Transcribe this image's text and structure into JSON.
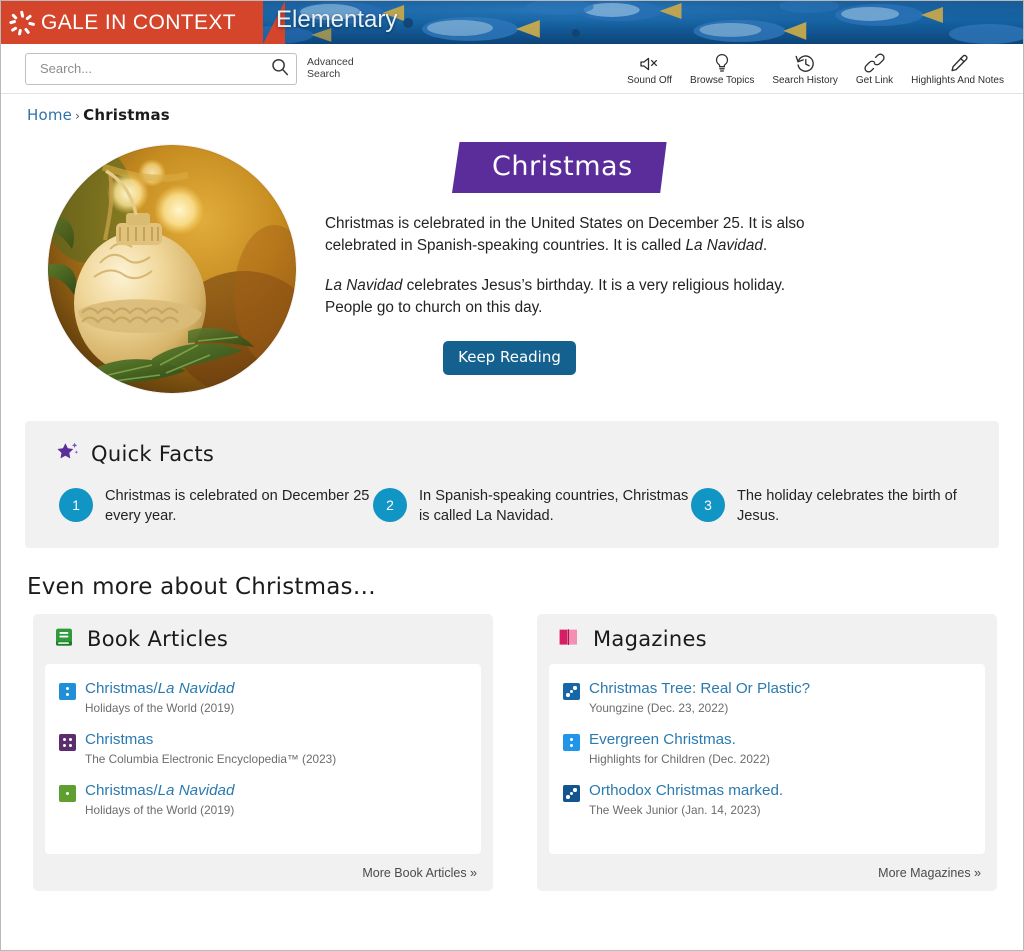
{
  "header": {
    "brand": "GALE IN CONTEXT",
    "edition": "Elementary",
    "logo_icon": "gale-starburst-icon",
    "banner_image_alt": "blue tang fish swimming underwater",
    "brand_color": "#d4452c",
    "banner_color": "#15538f"
  },
  "search": {
    "placeholder": "Search...",
    "value": "",
    "icon": "search-icon",
    "advanced_line1": "Advanced",
    "advanced_line2": "Search"
  },
  "tools": [
    {
      "label": "Sound Off",
      "icon": "speaker-mute-icon"
    },
    {
      "label": "Browse Topics",
      "icon": "lightbulb-icon"
    },
    {
      "label": "Search History",
      "icon": "clock-rewind-icon"
    },
    {
      "label": "Get Link",
      "icon": "link-chain-icon"
    },
    {
      "label": "Highlights And Notes",
      "icon": "highlighter-pen-icon"
    }
  ],
  "breadcrumb": {
    "home": "Home",
    "separator": "›",
    "current": "Christmas"
  },
  "hero": {
    "title": "Christmas",
    "title_color": "#5b2d9b",
    "image_alt": "Gold Christmas ornament hanging on a pine tree with golden bokeh lights",
    "paragraph1_a": "Christmas is celebrated in the United States on December 25. It is also celebrated in Spanish-speaking countries. It is called ",
    "paragraph1_italic": "La Navidad",
    "paragraph1_b": ".",
    "paragraph2_italic": "La Navidad",
    "paragraph2_b": " celebrates Jesus’s birthday. It is a very religious holiday. People go to church on this day.",
    "keep_reading_label": "Keep Reading",
    "keep_reading_color": "#14618f"
  },
  "quick_facts": {
    "title": "Quick Facts",
    "icon": "sparkle-star-icon",
    "number_color": "#1195c4",
    "items": [
      {
        "number": "1",
        "text": "Christmas is celebrated on December 25 every year."
      },
      {
        "number": "2",
        "text": "In Spanish-speaking countries, Christmas is called La Navidad."
      },
      {
        "number": "3",
        "text": "The holiday celebrates the birth of Jesus."
      }
    ]
  },
  "even_more_heading": "Even more about Christmas…",
  "panels": [
    {
      "title": "Book Articles",
      "icon": "green-book-icon",
      "icon_color": "#2e9a3b",
      "more_label": "More Book Articles »",
      "results": [
        {
          "title_a": "Christmas/",
          "title_italic": "La Navidad",
          "title_b": "",
          "source": "Holidays of the World (2019)",
          "level_icon": "reading-level-2-icon",
          "level_color": "#1f8fd8",
          "dots": 2
        },
        {
          "title_a": "Christmas",
          "title_italic": "",
          "title_b": "",
          "source": "The Columbia Electronic Encyclopedia™ (2023)",
          "level_icon": "reading-level-4-icon",
          "level_color": "#5b2d6e",
          "dots": 4
        },
        {
          "title_a": "Christmas/",
          "title_italic": "La Navidad",
          "title_b": "",
          "source": "Holidays of the World (2019)",
          "level_icon": "reading-level-1-icon",
          "level_color": "#5f9e31",
          "dots": 1
        }
      ]
    },
    {
      "title": "Magazines",
      "icon": "pink-open-book-icon",
      "icon_color": "#d81e63",
      "more_label": "More Magazines »",
      "results": [
        {
          "title_a": "Christmas Tree: Real Or Plastic?",
          "title_italic": "",
          "title_b": "",
          "source": "Youngzine (Dec. 23, 2022)",
          "level_icon": "reading-level-3-icon",
          "level_color": "#1766a8",
          "dots": 3
        },
        {
          "title_a": "Evergreen Christmas.",
          "title_italic": "",
          "title_b": "",
          "source": "Highlights for Children (Dec. 2022)",
          "level_icon": "reading-level-2-icon",
          "level_color": "#2196e8",
          "dots": 2
        },
        {
          "title_a": "Orthodox Christmas marked.",
          "title_italic": "",
          "title_b": "",
          "source": "The Week Junior (Jan. 14, 2023)",
          "level_icon": "reading-level-3-icon",
          "level_color": "#14558f",
          "dots": 3
        }
      ]
    }
  ]
}
